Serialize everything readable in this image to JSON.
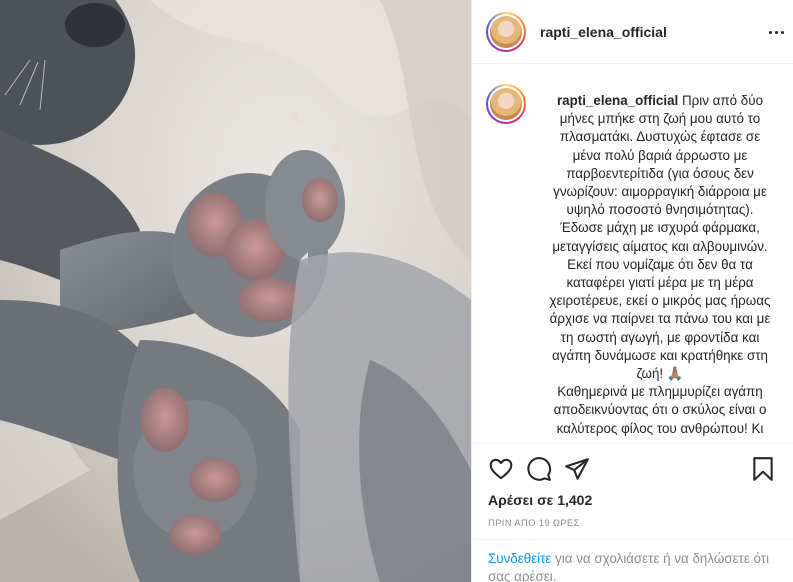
{
  "post": {
    "username": "rapti_elena_official",
    "caption_username": "rapti_elena_official",
    "caption_paragraphs": [
      "Πριν από δύο μήνες μπήκε στη ζωή μου αυτό το πλασματάκι. Δυστυχώς έφτασε σε μένα πολύ βαριά άρρωστο με παρβοεντερίτιδα (για όσους δεν γνωρίζουν: αιμορραγική διάρροια με υψηλό ποσοστό θνησιμότητας). Έδωσε μάχη με ισχυρά φάρμακα, μεταγγίσεις αίματος και αλβουμινών. Εκεί που νομίζαμε ότι δεν θα τα καταφέρει γιατί μέρα με τη μέρα χειροτέρευε, εκεί ο μικρός μας ήρωας άρχισε να παίρνει τα πάνω του και με τη σωστή αγωγή, με φροντίδα και αγάπη δυνάμωσε και κρατήθηκε στη ζωή! 🙏🏽",
      "Καθημερινά με πλημμυρίζει αγάπη αποδεικνύοντας ότι ο σκύλος είναι ο καλύτερος φίλος του ανθρώπου! Κι"
    ],
    "likes_text": "Αρέσει σε 1,402",
    "time_text": "ΠΡΙΝ ΑΠΟ 19 ΩΡΕΣ"
  },
  "icons": {
    "more": "more-options-icon",
    "like": "heart-icon",
    "comment": "comment-icon",
    "share": "share-icon",
    "save": "bookmark-icon"
  },
  "comment_prompt": {
    "link": "Συνδεθείτε",
    "rest": " για να σχολιάσετε ή να δηλώσετε ότι σας αρέσει."
  }
}
